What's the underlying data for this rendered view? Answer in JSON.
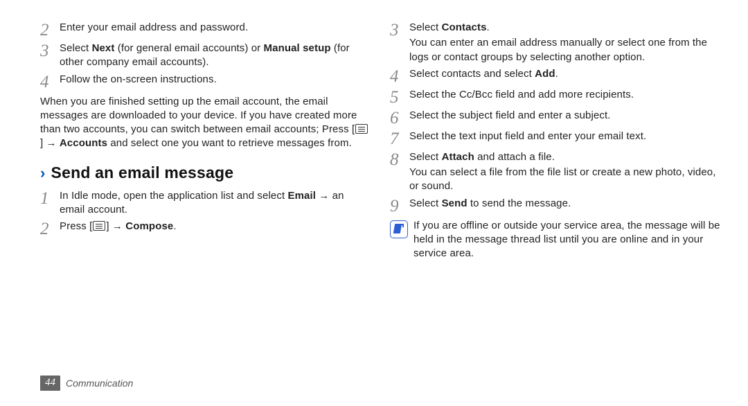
{
  "footer": {
    "page": "44",
    "section": "Communication"
  },
  "left": {
    "step2": {
      "n": "2",
      "text": "Enter your email address and password."
    },
    "step3": {
      "n": "3",
      "pre": "Select ",
      "b1": "Next",
      "mid": " (for general email accounts) or ",
      "b2": "Manual setup",
      "post": " (for other company email accounts)."
    },
    "step4": {
      "n": "4",
      "text": "Follow the on-screen instructions."
    },
    "para": {
      "pre": "When you are finished setting up the email account, the email messages are downloaded to your device. If you have created more than two accounts, you can switch between email accounts; Press [",
      "mid": "] → ",
      "b": "Accounts",
      "post": " and select one you want to retrieve messages from."
    },
    "heading": "Send an email message",
    "s1": {
      "n": "1",
      "pre": "In Idle mode, open the application list and select ",
      "b": "Email",
      "post": " → an email account."
    },
    "s2": {
      "n": "2",
      "pre": "Press [",
      "mid": "] → ",
      "b": "Compose",
      "post": "."
    }
  },
  "right": {
    "step3": {
      "n": "3",
      "pre": "Select ",
      "b": "Contacts",
      "post": ".",
      "sub": "You can enter an email address manually or select one from the logs or contact groups by selecting another option."
    },
    "step4": {
      "n": "4",
      "pre": "Select contacts and select ",
      "b": "Add",
      "post": "."
    },
    "step5": {
      "n": "5",
      "text": "Select the Cc/Bcc field and add more recipients."
    },
    "step6": {
      "n": "6",
      "text": "Select the subject field and enter a subject."
    },
    "step7": {
      "n": "7",
      "text": "Select the text input field and enter your email text."
    },
    "step8": {
      "n": "8",
      "pre": "Select ",
      "b": "Attach",
      "post": " and attach a file.",
      "sub": "You can select a file from the file list or create a new photo, video, or sound."
    },
    "step9": {
      "n": "9",
      "pre": "Select ",
      "b": "Send",
      "post": " to send the message."
    },
    "note": "If you are offline or outside your service area, the message will be held in the message thread list until you are online and in your service area."
  }
}
